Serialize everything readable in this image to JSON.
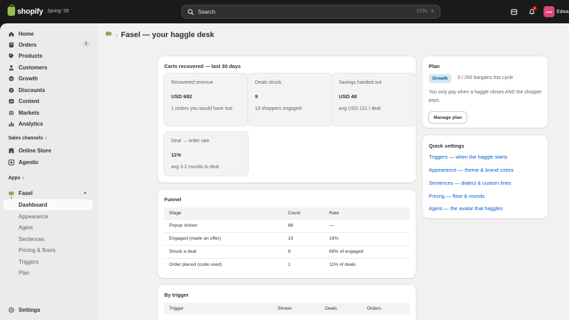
{
  "topbar": {
    "brand": "shopify",
    "tag": "Spring '26",
    "search_placeholder": "Search",
    "kbd_ctrl": "CTRL",
    "kbd_k": "K",
    "notif_count": "1",
    "avatar_initials": "new",
    "user_name": "Edwar"
  },
  "sidebar": {
    "main_items": [
      {
        "label": "Home",
        "icon": "home-icon"
      },
      {
        "label": "Orders",
        "icon": "orders-icon",
        "badge": "1"
      },
      {
        "label": "Products",
        "icon": "tag-icon"
      },
      {
        "label": "Customers",
        "icon": "person-icon"
      },
      {
        "label": "Growth",
        "icon": "growth-icon"
      },
      {
        "label": "Discounts",
        "icon": "discount-icon"
      },
      {
        "label": "Content",
        "icon": "content-icon"
      },
      {
        "label": "Markets",
        "icon": "globe-icon"
      },
      {
        "label": "Analytics",
        "icon": "chart-icon"
      }
    ],
    "sales_channels_label": "Sales channels",
    "sales_items": [
      {
        "label": "Online Store",
        "icon": "store-icon"
      },
      {
        "label": "Agentic",
        "icon": "agentic-icon"
      }
    ],
    "apps_label": "Apps",
    "app_name": "Fasel",
    "app_items": [
      "Dashboard",
      "Appearance",
      "Agent",
      "Sentences",
      "Pricing & floors",
      "Triggers",
      "Plan"
    ],
    "settings_label": "Settings"
  },
  "page": {
    "breadcrumb_sep": "›",
    "title": "Fasel — your haggle desk"
  },
  "carts": {
    "title": "Carts recovered — last 30 days",
    "stats": [
      {
        "label": "Recovered revenue",
        "value": "USD 682",
        "sub": "1 orders you would have lost"
      },
      {
        "label": "Deals struck",
        "value": "9",
        "sub": "13 shoppers engaged"
      },
      {
        "label": "Savings handed out",
        "value": "USD 48",
        "sub": "avg USD 121 / deal"
      },
      {
        "label": "Deal → order rate",
        "value": "11%",
        "sub": "avg 3.2 rounds to deal"
      }
    ]
  },
  "funnel": {
    "title": "Funnel",
    "headers": [
      "Stage",
      "Count",
      "Rate"
    ],
    "rows": [
      [
        "Popup shown",
        "88",
        "—"
      ],
      [
        "Engaged (made an offer)",
        "13",
        "19%"
      ],
      [
        "Struck a deal",
        "9",
        "69% of engaged"
      ],
      [
        "Order placed (code used)",
        "1",
        "11% of deals"
      ]
    ]
  },
  "by_trigger": {
    "title": "By trigger",
    "headers": [
      "Trigger",
      "Shown",
      "Deals",
      "Orders"
    ]
  },
  "plan": {
    "title": "Plan",
    "badge": "Growth",
    "usage": "0 / 200 bargains this cycle",
    "desc": "You only pay when a haggle closes AND the shopper pays.",
    "button": "Manage plan"
  },
  "quick": {
    "title": "Quick settings",
    "links": [
      "Triggers — when the haggle starts",
      "Appearance — theme & brand colors",
      "Sentences — dialect & custom lines",
      "Pricing — floor & rounds",
      "Agent — the avatar that haggles"
    ]
  },
  "colors": {
    "accent": "#005bd3",
    "topbar": "#1a1a1a",
    "plan_badge_bg": "#cfe9f7"
  }
}
